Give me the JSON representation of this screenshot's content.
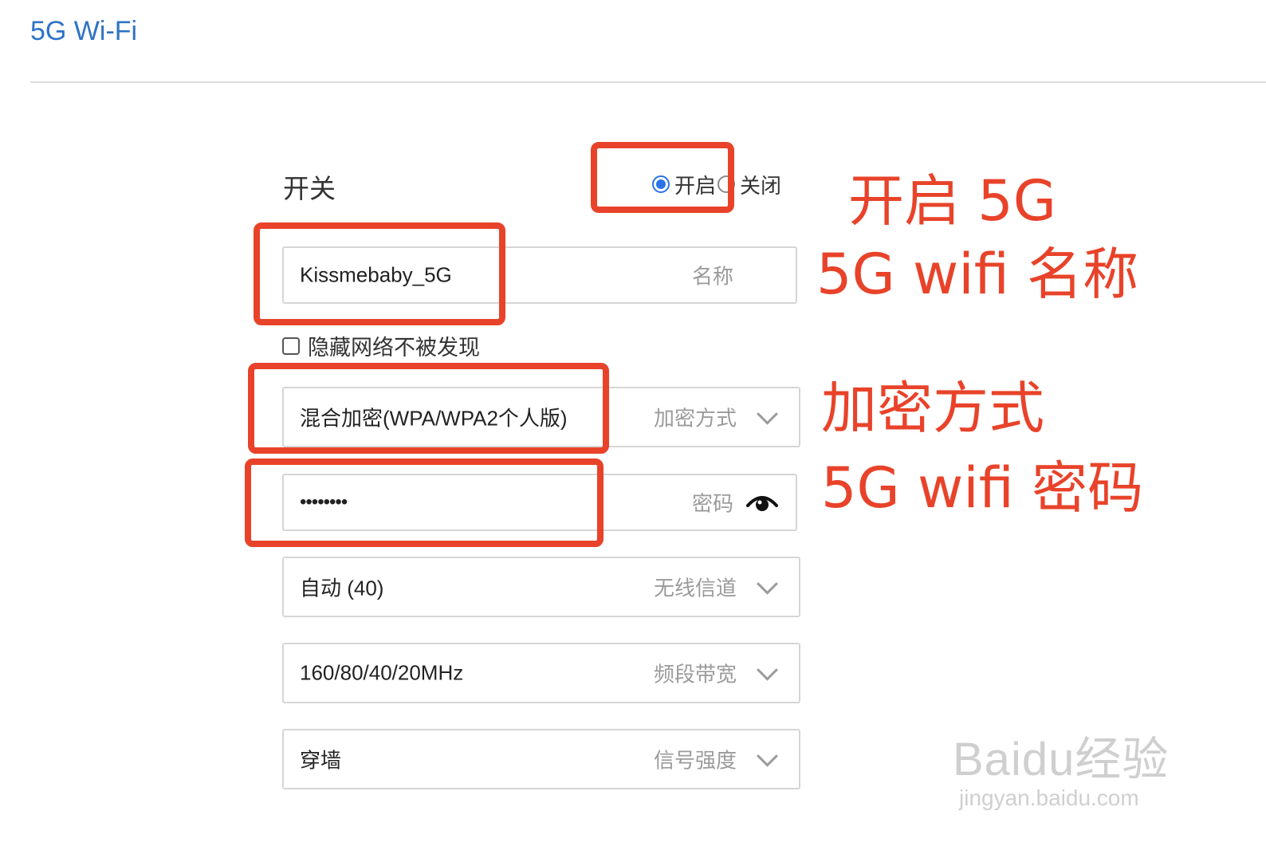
{
  "header": {
    "title": "5G Wi-Fi"
  },
  "switch": {
    "label": "开关",
    "options": [
      {
        "label": "开启",
        "selected": true
      },
      {
        "label": "关闭",
        "selected": false
      }
    ]
  },
  "ssid": {
    "value": "Kissmebaby_5G",
    "hint": "名称"
  },
  "hide_network": {
    "label": "隐藏网络不被发现",
    "checked": false
  },
  "encryption": {
    "value": "混合加密(WPA/WPA2个人版)",
    "hint": "加密方式"
  },
  "password": {
    "value": "••••••••",
    "hint": "密码"
  },
  "channel": {
    "value": "自动 (40)",
    "hint": "无线信道"
  },
  "bandwidth": {
    "value": "160/80/40/20MHz",
    "hint": "频段带宽"
  },
  "signal": {
    "value": "穿墙",
    "hint": "信号强度"
  },
  "annotations": {
    "enable_5g": "开启 5G",
    "wifi_name": "5G wifi 名称",
    "encryption_mode": "加密方式",
    "wifi_password": "5G wifi 密码"
  },
  "watermark": {
    "brand": "Baidu经验",
    "url": "jingyan.baidu.com"
  },
  "colors": {
    "accent_blue": "#2f73c6",
    "radio_blue": "#2b73e8",
    "annotation_red": "#e8432a"
  }
}
